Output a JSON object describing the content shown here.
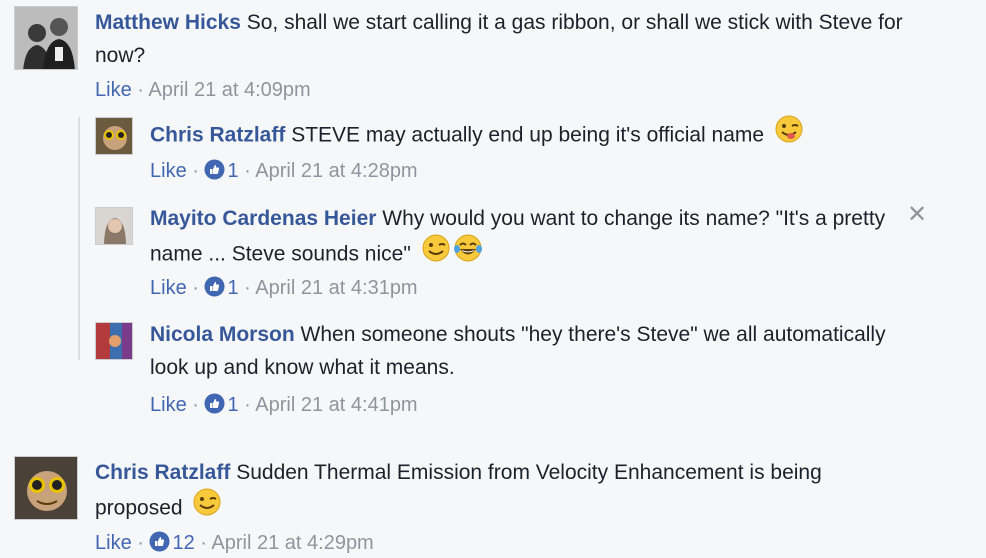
{
  "comments": [
    {
      "author": "Matthew Hicks",
      "text": "So, shall we start calling it a gas ribbon, or shall we stick with Steve for now?",
      "like_label": "Like",
      "separator": " · ",
      "reaction_count": "",
      "timestamp": "April 21 at 4:09pm"
    },
    {
      "author": "Chris Ratzlaff",
      "text": "STEVE may actually end up being it's official name",
      "like_label": "Like",
      "separator": " · ",
      "reaction_count": "1",
      "timestamp": "April 21 at 4:28pm",
      "emoji": "winking-tongue-emoji"
    },
    {
      "author": "Mayito Cardenas Heier",
      "text": "Why would you want to change its name? \"It's a pretty name ... Steve sounds nice\"",
      "like_label": "Like",
      "separator": " · ",
      "reaction_count": "1",
      "timestamp": "April 21 at 4:31pm",
      "emoji": "wink-and-tears-of-joy-emoji"
    },
    {
      "author": "Nicola Morson",
      "text": "When someone shouts \"hey there's Steve\" we all automatically look up and know what it means.",
      "like_label": "Like",
      "separator": " · ",
      "reaction_count": "1",
      "timestamp": "April 21 at 4:41pm"
    },
    {
      "author": "Chris Ratzlaff",
      "text": "Sudden Thermal Emission from Velocity Enhancement is being proposed",
      "like_label": "Like",
      "separator": " · ",
      "reaction_count": "12",
      "timestamp": "April 21 at 4:29pm",
      "emoji": "wink-emoji"
    }
  ],
  "close_glyph": "✕",
  "colors": {
    "name": "#365899",
    "like": "#4267b2",
    "meta": "#90949c",
    "background": "#f6f7f9"
  }
}
